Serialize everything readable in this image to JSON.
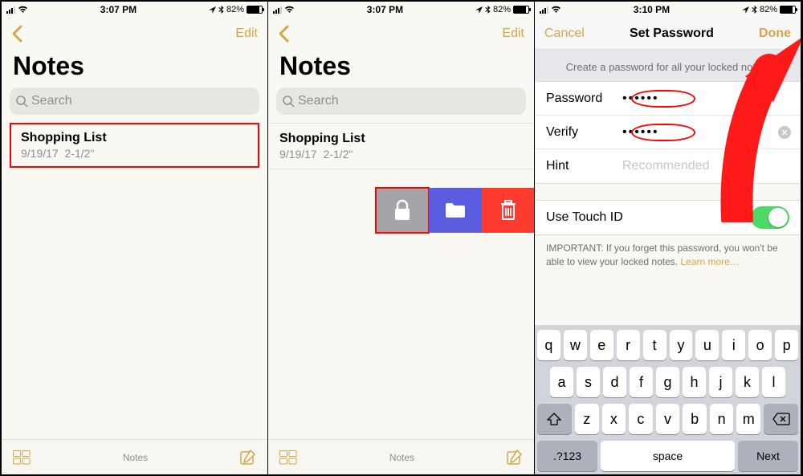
{
  "statusbar": {
    "time1": "3:07 PM",
    "time2": "3:07 PM",
    "time3": "3:10 PM",
    "battery_pct": "82%"
  },
  "panel1": {
    "edit": "Edit",
    "title": "Notes",
    "search_placeholder": "Search",
    "note": {
      "title": "Shopping List",
      "date": "9/19/17",
      "preview": "2-1/2\""
    },
    "toolbar_label": "Notes"
  },
  "panel2": {
    "edit": "Edit",
    "title": "Notes",
    "search_placeholder": "Search",
    "note": {
      "title": "Shopping List",
      "date": "9/19/17",
      "preview": "2-1/2\""
    },
    "toolbar_label": "Notes"
  },
  "panel3": {
    "cancel": "Cancel",
    "title": "Set Password",
    "done": "Done",
    "banner": "Create a password for all your locked notes.",
    "password_label": "Password",
    "password_value": "••••••",
    "verify_label": "Verify",
    "verify_value": "••••••",
    "hint_label": "Hint",
    "hint_placeholder": "Recommended",
    "touchid_label": "Use Touch ID",
    "touchid_on": true,
    "important": "IMPORTANT: If you forget this password, you won't be able to view your locked notes. ",
    "learn_more": "Learn more…"
  },
  "keyboard": {
    "row1": [
      "q",
      "w",
      "e",
      "r",
      "t",
      "y",
      "u",
      "i",
      "o",
      "p"
    ],
    "row2": [
      "a",
      "s",
      "d",
      "f",
      "g",
      "h",
      "j",
      "k",
      "l"
    ],
    "row3": [
      "z",
      "x",
      "c",
      "v",
      "b",
      "n",
      "m"
    ],
    "mode_key": ".?123",
    "space": "space",
    "next": "Next"
  }
}
